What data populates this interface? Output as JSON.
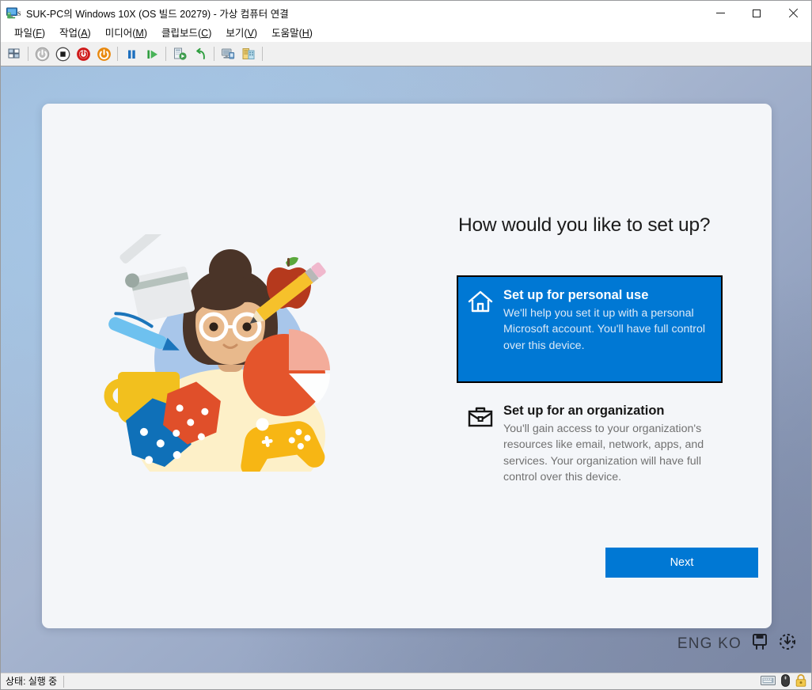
{
  "window": {
    "icon": "virtual-machine-connection-icon",
    "title": "SUK-PC의 Windows 10X (OS 빌드 20279) - 가상 컴퓨터 연결",
    "controls": {
      "minimize": "minimize-icon",
      "maximize": "maximize-icon",
      "close": "close-icon"
    }
  },
  "menubar": {
    "items": [
      {
        "label": "파일",
        "mnemonic": "F"
      },
      {
        "label": "작업",
        "mnemonic": "A"
      },
      {
        "label": "미디어",
        "mnemonic": "M"
      },
      {
        "label": "클립보드",
        "mnemonic": "C"
      },
      {
        "label": "보기",
        "mnemonic": "V"
      },
      {
        "label": "도움말",
        "mnemonic": "H"
      }
    ]
  },
  "toolbar": {
    "buttons": [
      {
        "name": "ctrl-alt-delete-icon",
        "kind": "keys"
      },
      {
        "name": "shutdown-icon",
        "kind": "power-gray"
      },
      {
        "name": "turn-off-icon",
        "kind": "stop-black"
      },
      {
        "name": "reset-icon",
        "kind": "power-red"
      },
      {
        "name": "start-icon",
        "kind": "power-orange"
      },
      {
        "name": "pause-icon",
        "kind": "pause-blue"
      },
      {
        "name": "resume-icon",
        "kind": "play-green"
      },
      {
        "name": "checkpoint-icon",
        "kind": "snapshot"
      },
      {
        "name": "revert-icon",
        "kind": "undo-green"
      },
      {
        "name": "enhanced-session-icon",
        "kind": "screen"
      },
      {
        "name": "settings-icon",
        "kind": "settings"
      }
    ]
  },
  "oobe": {
    "heading": "How would you like to set up?",
    "illustration": "personal-setup-illustration",
    "options": [
      {
        "icon": "home-icon",
        "title": "Set up for personal use",
        "description": "We'll help you set it up with a personal Microsoft account. You'll have full control over this device.",
        "selected": true
      },
      {
        "icon": "briefcase-icon",
        "title": "Set up for an organization",
        "description": "You'll gain access to your organization's resources like email, network, apps, and services. Your organization will have full control over this device.",
        "selected": false
      }
    ],
    "next_label": "Next"
  },
  "desktop_tray": {
    "language": "ENG KO",
    "icons": [
      "ime-mode-icon",
      "accessibility-icon"
    ]
  },
  "statusbar": {
    "status": "상태: 실행 중",
    "icons": [
      "keyboard-icon",
      "mouse-icon",
      "lock-icon"
    ]
  },
  "colors": {
    "accent": "#0078d4",
    "selected_tile_border": "#000000",
    "card_bg": "#f4f6f9",
    "heading": "#1b1b1b",
    "muted_text": "#717171"
  }
}
